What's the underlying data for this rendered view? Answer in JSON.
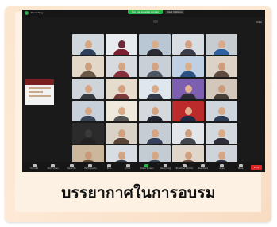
{
  "caption": "บรรยากาศในการอบรม",
  "colors": {
    "frame_bg": "#fbe6cf",
    "zoom_bg": "#1a1a1a",
    "accent_green": "#2cb34a",
    "end_red": "#e02828"
  },
  "zoom": {
    "recording_label": "Recording",
    "viewing_banner": "You are viewing screen",
    "view_options_label": "View Options",
    "view_label": "View",
    "toolbar": [
      {
        "label": "Unmute",
        "icon": "microphone-icon"
      },
      {
        "label": "Start Video",
        "icon": "video-camera-icon"
      },
      {
        "label": "Security",
        "icon": "shield-icon"
      },
      {
        "label": "Participants",
        "icon": "participants-icon"
      },
      {
        "label": "Polls",
        "icon": "polls-icon"
      },
      {
        "label": "Chat",
        "icon": "chat-icon"
      },
      {
        "label": "Share Screen",
        "icon": "share-screen-icon",
        "green": true
      },
      {
        "label": "Recording",
        "icon": "record-icon"
      },
      {
        "label": "Breakout Rooms",
        "icon": "breakout-rooms-icon"
      },
      {
        "label": "Reactions",
        "icon": "reactions-icon"
      },
      {
        "label": "Apps",
        "icon": "apps-icon"
      },
      {
        "label": "More",
        "icon": "more-icon"
      }
    ],
    "end_label": "End",
    "tiles": [
      {
        "bg": "#cfd6dc",
        "face": "#d7a784",
        "body": "#2f3f5a"
      },
      {
        "bg": "#e9ecef",
        "face": "#6a2a3a",
        "body": "#7a1f30"
      },
      {
        "bg": "#b9c7d5",
        "face": "#d9ad8c",
        "body": "#2b2b35"
      },
      {
        "bg": "#d8dde4",
        "face": "#d4a07f",
        "body": "#3c3c4a"
      },
      {
        "bg": "#c7ccd1",
        "face": "#d9ab89",
        "body": "#2e5fa0"
      },
      {
        "bg": "#e3d7c8",
        "face": "#caa07f",
        "body": "#6b5746"
      },
      {
        "bg": "#d7dbe0",
        "face": "#d6a684",
        "body": "#8a2d3b"
      },
      {
        "bg": "#c9cfd6",
        "face": "#d3a382",
        "body": "#4b5561"
      },
      {
        "bg": "#bfd0e4",
        "face": "#d9ae8d",
        "body": "#2c4f82"
      },
      {
        "bg": "#dcd3c6",
        "face": "#cf9d7b",
        "body": "#5e4a3f"
      },
      {
        "bg": "#ced4da",
        "face": "#d6a583",
        "body": "#3b3b44"
      },
      {
        "bg": "#e6dccd",
        "face": "#d3a07e",
        "body": "#7c3b3b"
      },
      {
        "bg": "#e0e6ee",
        "face": "#d8aa88",
        "body": "#333a4a"
      },
      {
        "bg": "#7d5fb0",
        "face": "#e3b491",
        "body": "#2a2a35"
      },
      {
        "bg": "#d2c7ba",
        "face": "#cc9b79",
        "body": "#4a3e38"
      },
      {
        "bg": "#c7d0da",
        "face": "#d5a583",
        "body": "#3a4456"
      },
      {
        "bg": "#efe8dc",
        "face": "#d8a987",
        "body": "#555"
      },
      {
        "bg": "#d5d9de",
        "face": "#d3a381",
        "body": "#242430"
      },
      {
        "bg": "#bb2b2b",
        "face": "#e0b08e",
        "body": "#1e2a44"
      },
      {
        "bg": "#cfd5dc",
        "face": "#d7a886",
        "body": "#2d3c55"
      },
      {
        "bg": "#2b2b2b",
        "face": "#3a3a3a",
        "body": "#222"
      },
      {
        "bg": "#d9d2c6",
        "face": "#d2a17f",
        "body": "#5a4438"
      },
      {
        "bg": "#c5ccd4",
        "face": "#d6a684",
        "body": "#35405a"
      },
      {
        "bg": "#e2e6ea",
        "face": "#cf9e7c",
        "body": "#46464e"
      },
      {
        "bg": "#d3d8de",
        "face": "#d9ab89",
        "body": "#2e2e3a"
      },
      {
        "bg": "#cdb79c",
        "face": "#c99877",
        "body": "#5b4636"
      },
      {
        "bg": "#d8dde3",
        "face": "#d4a482",
        "body": "#343b4a"
      },
      {
        "bg": "#c3cbd3",
        "face": "#d7a785",
        "body": "#3c4758"
      },
      {
        "bg": "#e0d6c9",
        "face": "#d1a07e",
        "body": "#6a4a3a"
      },
      {
        "bg": "#cfd4da",
        "face": "#d6a684",
        "body": "#2f3545"
      }
    ]
  }
}
